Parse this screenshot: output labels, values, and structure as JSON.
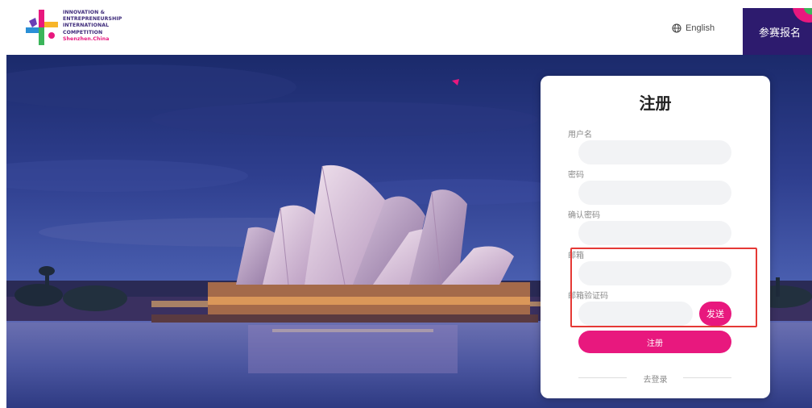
{
  "header": {
    "logo_lines": [
      "INNOVATION &",
      "ENTREPRENEURSHIP",
      "INTERNATIONAL",
      "COMPETITION"
    ],
    "logo_subline": "Shenzhen.China",
    "language_label": "English",
    "signup_label": "参赛报名"
  },
  "form": {
    "title": "注册",
    "username_label": "用户名",
    "password_label": "密码",
    "confirm_password_label": "确认密码",
    "email_label": "邮箱",
    "email_code_label": "邮箱验证码",
    "send_label": "发送",
    "submit_label": "注册",
    "login_link": "去登录"
  },
  "colors": {
    "brand_pink": "#e8187e",
    "brand_purple": "#2d1b6e",
    "highlight_red": "#e53935"
  }
}
